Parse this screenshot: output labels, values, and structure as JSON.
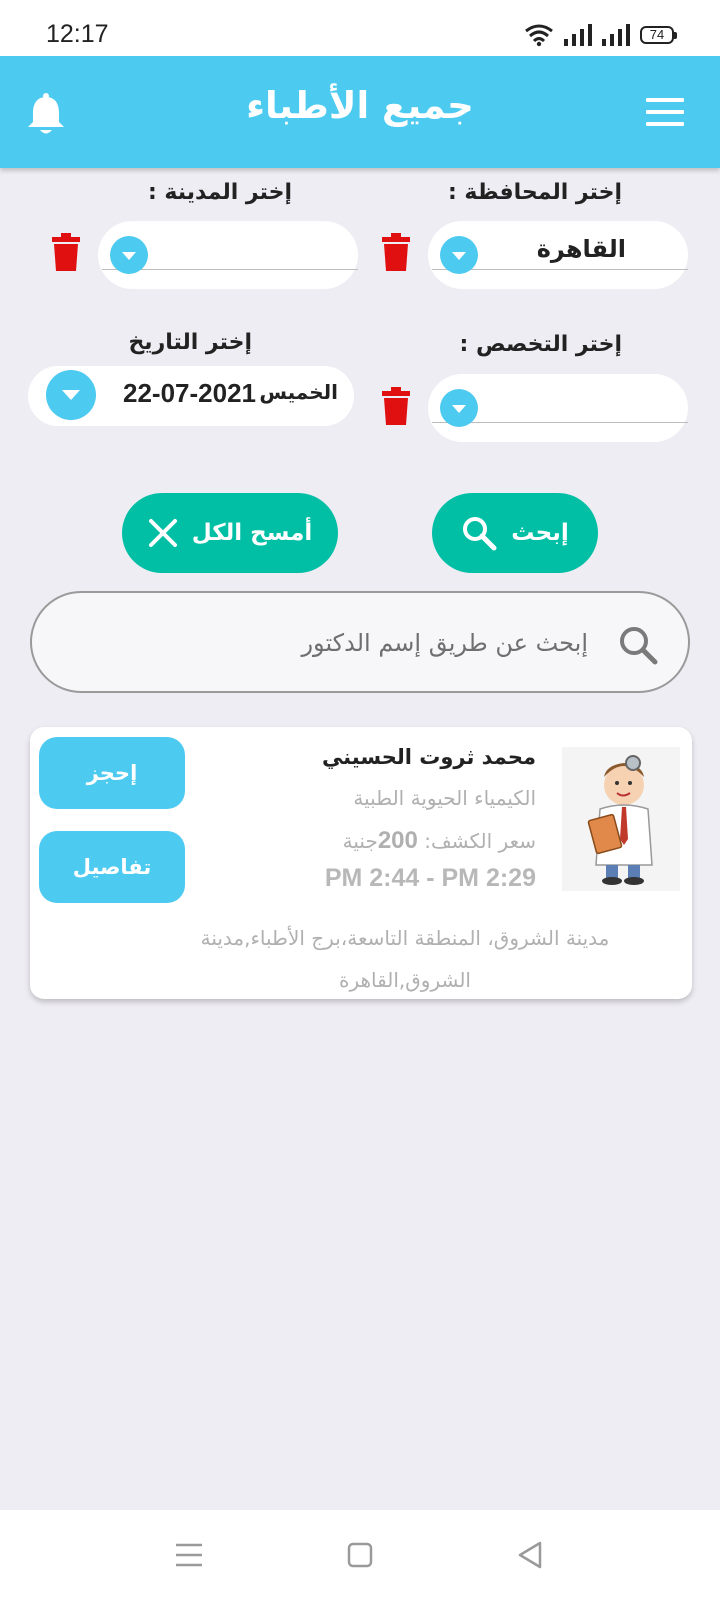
{
  "status_bar": {
    "time": "12:17",
    "battery": "74",
    "icons": [
      "wifi-icon",
      "signal-icon",
      "signal-icon",
      "battery-icon"
    ]
  },
  "app_bar": {
    "title": "جميع الأطباء",
    "icons": [
      "menu-icon",
      "bell-icon"
    ]
  },
  "filters": {
    "governorate": {
      "label": "إختر المحافظة :",
      "value": "القاهرة"
    },
    "city": {
      "label": "إختر المدينة :",
      "value": ""
    },
    "specialty": {
      "label": "إختر التخصص :",
      "value": ""
    },
    "date": {
      "label": "إختر التاريخ",
      "value": "22-07-2021",
      "day": "الخميس"
    }
  },
  "buttons": {
    "search": "إبحث",
    "clear_all": "أمسح الكل"
  },
  "search": {
    "placeholder": "إبحث عن طريق إسم الدكتور"
  },
  "doctors": [
    {
      "name": "محمد ثروت الحسيني",
      "specialty": "الكيمياء الحيوية الطبية",
      "price_label": "سعر الكشف:",
      "price_value": "200",
      "price_unit": "جنية",
      "time_range": "PM 2:44 - PM 2:29",
      "address": "مدينة الشروق، المنطقة التاسعة،برج الأطباء,مدينة الشروق,القاهرة",
      "book_label": "إحجز",
      "details_label": "تفاصيل"
    }
  ],
  "colors": {
    "accent": "#4dcaf0",
    "action": "#00bfa5",
    "delete": "#e01010",
    "background": "#eeedf3"
  }
}
